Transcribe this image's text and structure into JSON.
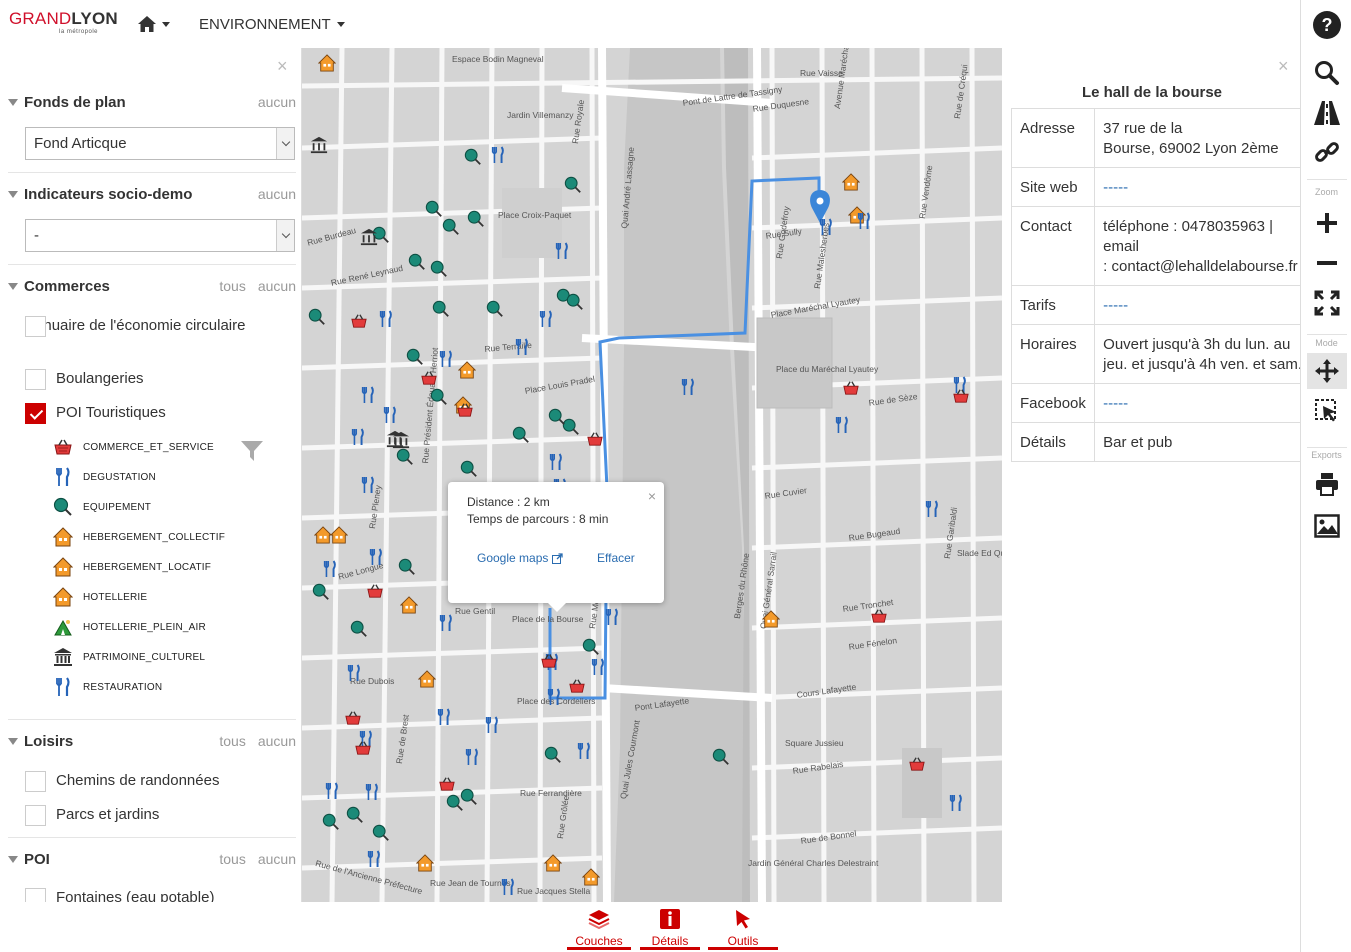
{
  "header": {
    "logo": {
      "grand": "GRAND",
      "lyon": "LYON",
      "sub": "la métropole"
    },
    "home_icon": "home-icon",
    "menu_label": "ENVIRONNEMENT"
  },
  "left_panel": {
    "fonds": {
      "title": "Fonds de plan",
      "none_label": "aucun",
      "selected": "Fond Articque"
    },
    "indicateurs": {
      "title": "Indicateurs socio-demo",
      "none_label": "aucun",
      "selected": "-"
    },
    "commerces": {
      "title": "Commerces",
      "all_label": "tous",
      "none_label": "aucun",
      "items": [
        {
          "label": "Annuaire de l'économie circulaire",
          "checked": false
        },
        {
          "label": "Boulangeries",
          "checked": false
        },
        {
          "label": "POI Touristiques",
          "checked": true
        }
      ],
      "legend": [
        {
          "label": "COMMERCE_ET_SERVICE",
          "icon": "basket-icon"
        },
        {
          "label": "DEGUSTATION",
          "icon": "fork-knife-icon"
        },
        {
          "label": "EQUIPEMENT",
          "icon": "equipment-pin-icon"
        },
        {
          "label": "HEBERGEMENT_COLLECTIF",
          "icon": "house-icon"
        },
        {
          "label": "HEBERGEMENT_LOCATIF",
          "icon": "house-icon"
        },
        {
          "label": "HOTELLERIE",
          "icon": "house-icon"
        },
        {
          "label": "HOTELLERIE_PLEIN_AIR",
          "icon": "tent-icon"
        },
        {
          "label": "PATRIMOINE_CULTUREL",
          "icon": "monument-icon"
        },
        {
          "label": "RESTAURATION",
          "icon": "fork-knife-icon"
        }
      ]
    },
    "loisirs": {
      "title": "Loisirs",
      "all_label": "tous",
      "none_label": "aucun",
      "items": [
        {
          "label": "Chemins de randonnées",
          "checked": false
        },
        {
          "label": "Parcs et jardins",
          "checked": false
        }
      ]
    },
    "poi": {
      "title": "POI",
      "all_label": "tous",
      "none_label": "aucun",
      "items": [
        {
          "label": "Fontaines (eau potable)",
          "checked": false
        }
      ]
    }
  },
  "map": {
    "streets": [
      "Espace Bodin Magneval",
      "Jardin Villemanzy",
      "Rue Royale",
      "Place Croix-Paquet",
      "Rue René Leynaud",
      "Rue Burdeau",
      "Rue Terraille",
      "Place Louis Pradel",
      "Rue Longue",
      "Rue Gentil",
      "Place de la Bourse",
      "Rue Dubois",
      "Place des Cordeliers",
      "Rue Ferrandière",
      "Rue de l'Ancienne Préfecture",
      "Rue Jean de Tournes",
      "Rue Jacques Stella",
      "Quai André Lassagne",
      "Pont de Lattre de Tassigny",
      "Rue Duquesne",
      "Rue Vaisse",
      "Rue Sully",
      "Rue Godefroy",
      "Place Maréchal Lyautey",
      "Place du Maréchal Lyautey",
      "Rue de Sèze",
      "Rue Cuvier",
      "Rue Bugeaud",
      "Rue Tronchet",
      "Rue Fénelon",
      "Cours Lafayette",
      "Square Jussieu",
      "Rue Rabelais",
      "Rue de Bonnel",
      "Jardin Général Charles Delestraint",
      "Quai Jules Courmont",
      "Berges du Rhône",
      "Quai Général Sarrail",
      "Pont Lafayette",
      "Avenue Maréchal Foch",
      "Rue Malesherbes",
      "Rue Vendôme",
      "Rue de Créqui",
      "Rue Garibaldi",
      "Rue Grôlée",
      "Rue Président Édouard Herriot",
      "Rue de Brest",
      "Rue Mercière",
      "Rue Pleney",
      "Slade Ed Quinet"
    ],
    "popup": {
      "distance": "Distance : 2 km",
      "time": "Temps de parcours : 8 min",
      "google_label": "Google maps",
      "clear_label": "Effacer"
    }
  },
  "detail": {
    "title": "Le hall de la bourse",
    "rows": [
      {
        "key": "Adresse",
        "value": "37 rue de la\nBourse, 69002 Lyon 2ème"
      },
      {
        "key": "Site web",
        "value": "-----"
      },
      {
        "key": "Contact",
        "value": "téléphone : 0478035963 |\nemail\n: contact@lehalldelabourse.fr"
      },
      {
        "key": "Tarifs",
        "value": "-----"
      },
      {
        "key": "Horaires",
        "value": "Ouvert jusqu'à 3h du lun. au\njeu. et jusqu'à 4h ven. et sam."
      },
      {
        "key": "Facebook",
        "value": "-----"
      },
      {
        "key": "Détails",
        "value": "Bar et pub"
      }
    ]
  },
  "toolbar": {
    "zoom_label": "Zoom",
    "mode_label": "Mode",
    "exports_label": "Exports",
    "buttons": [
      "help-icon",
      "search-icon",
      "road-icon",
      "link-icon",
      "zoom-in-icon",
      "zoom-out-icon",
      "fullscreen-icon",
      "pan-icon",
      "select-icon",
      "print-icon",
      "image-icon"
    ]
  },
  "bottom_tabs": [
    {
      "label": "Couches",
      "icon": "layers-icon"
    },
    {
      "label": "Détails",
      "icon": "info-icon"
    },
    {
      "label": "Outils",
      "icon": "cursor-icon"
    }
  ],
  "colors": {
    "accent": "#cc0000",
    "route": "#4a90e2",
    "link": "#2a6cb0",
    "river": "#c9c9c9"
  }
}
